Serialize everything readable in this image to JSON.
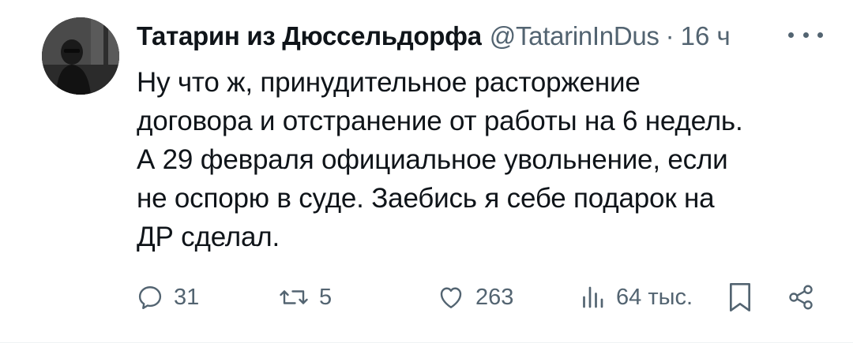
{
  "tweet": {
    "display_name": "Татарин из Дюссельдорфа",
    "handle": "@TatarinInDus",
    "separator": "·",
    "time": "16 ч",
    "text": "Ну что ж, принудительное расторжение\nдоговора и отстранение от работы на 6 недель.\nА 29 февраля официальное увольнение, если\nне оспорю в суде. Заебись я себе подарок на\nДР сделал."
  },
  "actions": {
    "replies": "31",
    "reposts": "5",
    "likes": "263",
    "views": "64 тыс."
  },
  "icons": {
    "avatar": "profile-photo",
    "more": "more-horizontal-icon",
    "reply": "reply-icon",
    "repost": "repost-icon",
    "like": "heart-icon",
    "views": "views-chart-icon",
    "bookmark": "bookmark-icon",
    "share": "share-icon"
  },
  "colors": {
    "text_primary": "#0f1419",
    "text_secondary": "#536471",
    "background": "#ffffff"
  }
}
